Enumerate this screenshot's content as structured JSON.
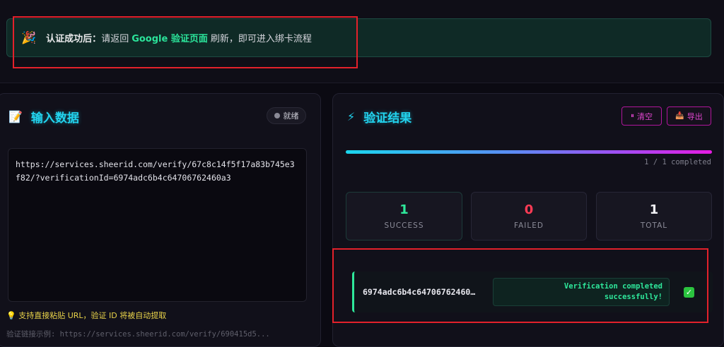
{
  "notice": {
    "icon": "party-popper-icon",
    "lead": "认证成功后：",
    "text_before": "请返回",
    "link": "Google 验证页面",
    "text_after": "刷新，即可进入绑卡流程"
  },
  "input_panel": {
    "title": "输入数据",
    "title_icon": "memo-icon",
    "status": "就绪",
    "url_value": "https://services.sheerid.com/verify/67c8c14f5f17a83b745e3f82/?verificationId=6974adc6b4c64706762460a3",
    "tip": "💡 支持直接粘贴 URL，验证 ID 将被自动提取",
    "example": "验证链接示例: https://services.sheerid.com/verify/690415d5..."
  },
  "result_panel": {
    "title": "验证结果",
    "title_icon": "lightning-icon",
    "clear_label": "清空",
    "export_label": "导出",
    "progress_fraction": 1.0,
    "progress_label": "1 / 1 completed",
    "stats": {
      "success_value": "1",
      "success_label": "SUCCESS",
      "failed_value": "0",
      "failed_label": "FAILED",
      "total_value": "1",
      "total_label": "TOTAL"
    },
    "results": [
      {
        "id": "6974adc6b4c64706762460…",
        "message_line1": "Verification completed",
        "message_line2": "successfully!",
        "status": "success"
      }
    ]
  },
  "colors": {
    "accent_cyan": "#22d3ee",
    "success_green": "#2ee89b",
    "failed_red": "#ff3b55",
    "magenta": "#e046cf",
    "highlight_red": "#e3212b"
  }
}
